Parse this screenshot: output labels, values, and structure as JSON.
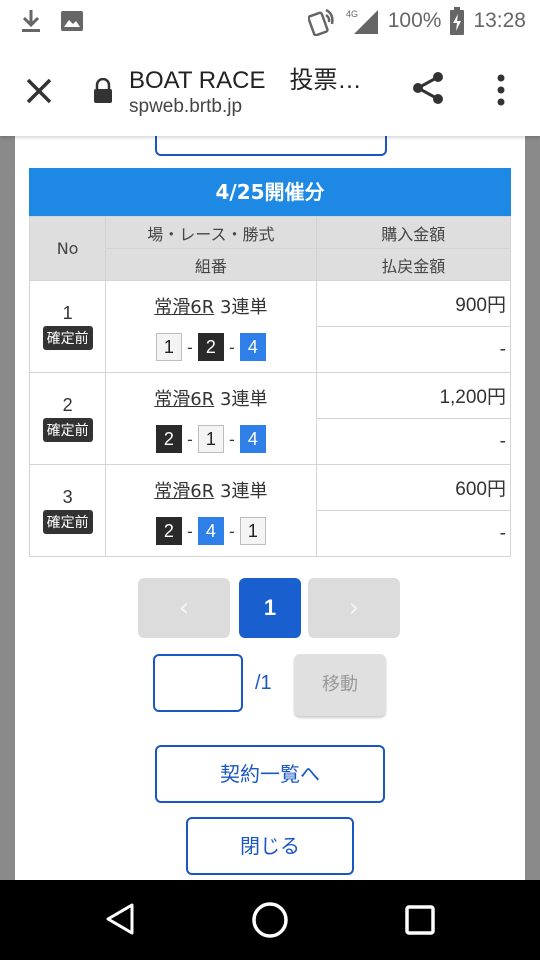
{
  "status_bar": {
    "network": "4G",
    "battery": "100%",
    "time": "13:28"
  },
  "browser": {
    "title": "BOAT RACE　投票…",
    "url": "spweb.brtb.jp"
  },
  "section": {
    "date_header": "4/25開催分"
  },
  "table": {
    "headers": {
      "no": "No",
      "race": "場・レース・勝式",
      "combo": "組番",
      "purchase": "購入金額",
      "payout": "払戻金額"
    },
    "rows": [
      {
        "no": "1",
        "status": "確定前",
        "race": "常滑6R",
        "type": "3連単",
        "combo": [
          "1",
          "2",
          "4"
        ],
        "purchase": "900円",
        "payout": "-"
      },
      {
        "no": "2",
        "status": "確定前",
        "race": "常滑6R",
        "type": "3連単",
        "combo": [
          "2",
          "1",
          "4"
        ],
        "purchase": "1,200円",
        "payout": "-"
      },
      {
        "no": "3",
        "status": "確定前",
        "race": "常滑6R",
        "type": "3連単",
        "combo": [
          "2",
          "4",
          "1"
        ],
        "purchase": "600円",
        "payout": "-"
      }
    ],
    "separator": "-"
  },
  "pagination": {
    "prev": "‹",
    "current": "1",
    "next": "›",
    "input_value": "",
    "total": "/1",
    "move_label": "移動"
  },
  "buttons": {
    "contract_list": "契約一覧へ",
    "close": "閉じる"
  },
  "colors": {
    "header_blue": "#1e88e5",
    "accent_blue": "#1a57c4",
    "boat_1": "#f4f4f4",
    "boat_2": "#2a2a2a",
    "boat_4": "#2f7fe8"
  }
}
